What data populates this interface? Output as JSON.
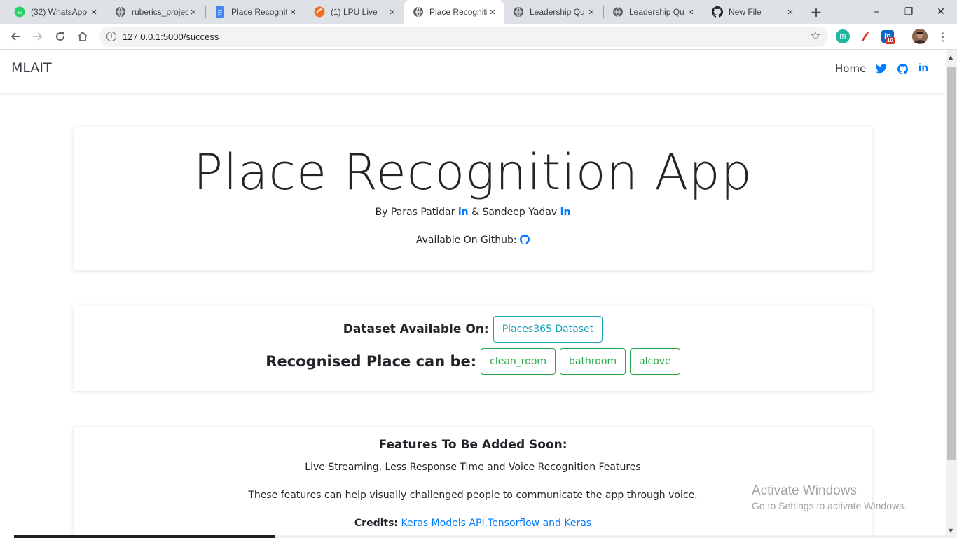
{
  "browser": {
    "tabs": [
      {
        "title": "(32) WhatsApp",
        "badge": "32"
      },
      {
        "title": "ruberics_projec"
      },
      {
        "title": "Place Recogniti"
      },
      {
        "title": "(1) LPU Live"
      },
      {
        "title": "Place Recogniti"
      },
      {
        "title": "Leadership Qu"
      },
      {
        "title": "Leadership Qu"
      },
      {
        "title": "New File"
      }
    ],
    "new_tab": "+",
    "url": "127.0.0.1:5000/success",
    "extensions": {
      "m_label": "m",
      "linkedin_label": "in",
      "linkedin_badge": "10"
    },
    "window_buttons": {
      "minimize": "–",
      "restore": "❐",
      "close": "✕"
    }
  },
  "navbar": {
    "brand": "MLAIT",
    "home": "Home"
  },
  "hero": {
    "title": "Place Recognition App",
    "byline_prefix": "By Paras Patidar",
    "byline_amp": "&",
    "byline_second": "Sandeep Yadav",
    "linkedin_glyph": "in",
    "github_text": "Available On Github:"
  },
  "dataset": {
    "label": "Dataset Available On:",
    "button": "Places365 Dataset",
    "recognised_label": "Recognised Place can be:",
    "places": [
      "clean_room",
      "bathroom",
      "alcove"
    ]
  },
  "features": {
    "title": "Features To Be Added Soon:",
    "list": "Live Streaming, Less Response Time and Voice Recognition Features",
    "description": "These features can help visually challenged people to communicate the app through voice.",
    "credits_label": "Credits:",
    "credits_link": "Keras Models API,Tensorflow and Keras"
  },
  "watermark": {
    "line1": "Activate Windows",
    "line2": "Go to Settings to activate Windows."
  },
  "colors": {
    "link_blue": "#007bff",
    "teal": "#17a2b8",
    "green": "#28a745",
    "twitter": "#1da1f2"
  }
}
